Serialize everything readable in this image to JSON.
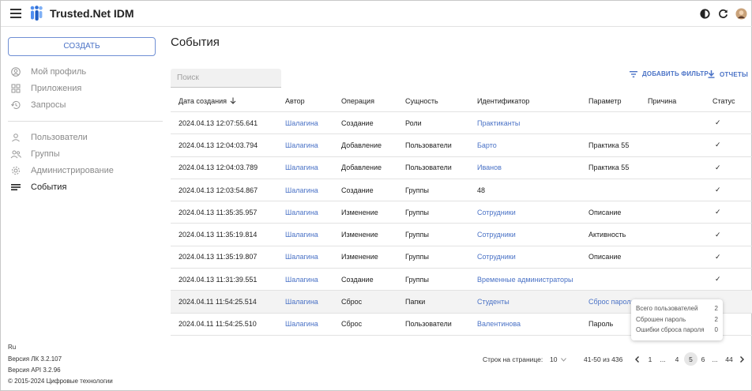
{
  "header": {
    "title": "Trusted.Net IDM",
    "icons": [
      "menu-icon",
      "theme-toggle-icon",
      "refresh-icon",
      "user-avatar-icon"
    ],
    "brand_color": "#2f6fd6"
  },
  "sidebar": {
    "create_label": "СОЗДАТЬ",
    "items": [
      {
        "label": "Мой профиль",
        "icon": "profile-icon"
      },
      {
        "label": "Приложения",
        "icon": "apps-icon"
      },
      {
        "label": "Запросы",
        "icon": "history-icon"
      },
      {
        "label": "Пользователи",
        "icon": "user-icon"
      },
      {
        "label": "Группы",
        "icon": "group-icon"
      },
      {
        "label": "Администрирование",
        "icon": "settings-icon"
      },
      {
        "label": "События",
        "icon": "events-icon",
        "active": true
      }
    ],
    "footer": {
      "lang": "Ru",
      "lk_version": "Версия ЛК 3.2.107",
      "api_version": "Версия API 3.2.96",
      "copyright": "© 2015-2024 Цифровые технологии"
    }
  },
  "main": {
    "title": "События",
    "search_placeholder": "Поиск",
    "add_filter_label": "ДОБАВИТЬ ФИЛЬТР",
    "reports_label": "ОТЧЕТЫ",
    "columns": [
      "Дата создания",
      "Автор",
      "Операция",
      "Сущность",
      "Идентификатор",
      "Параметр",
      "Причина",
      "Статус"
    ],
    "rows": [
      {
        "date": "2024.04.13 12:07:55.641",
        "author": "Шалагина",
        "op": "Создание",
        "entity": "Роли",
        "id": "Практиканты",
        "id_link": true,
        "param": "",
        "param_link": false,
        "reason": "",
        "status": "✓"
      },
      {
        "date": "2024.04.13 12:04:03.794",
        "author": "Шалагина",
        "op": "Добавление",
        "entity": "Пользователи",
        "id": "Барто",
        "id_link": true,
        "param": "Практика 55",
        "param_link": false,
        "reason": "",
        "status": "✓"
      },
      {
        "date": "2024.04.13 12:04:03.789",
        "author": "Шалагина",
        "op": "Добавление",
        "entity": "Пользователи",
        "id": "Иванов",
        "id_link": true,
        "param": "Практика 55",
        "param_link": false,
        "reason": "",
        "status": "✓"
      },
      {
        "date": "2024.04.13 12:03:54.867",
        "author": "Шалагина",
        "op": "Создание",
        "entity": "Группы",
        "id": "48",
        "id_link": false,
        "param": "",
        "param_link": false,
        "reason": "",
        "status": "✓"
      },
      {
        "date": "2024.04.13 11:35:35.957",
        "author": "Шалагина",
        "op": "Изменение",
        "entity": "Группы",
        "id": "Сотрудники",
        "id_link": true,
        "param": "Описание",
        "param_link": false,
        "reason": "",
        "status": "✓"
      },
      {
        "date": "2024.04.13 11:35:19.814",
        "author": "Шалагина",
        "op": "Изменение",
        "entity": "Группы",
        "id": "Сотрудники",
        "id_link": true,
        "param": "Активность",
        "param_link": false,
        "reason": "",
        "status": "✓"
      },
      {
        "date": "2024.04.13 11:35:19.807",
        "author": "Шалагина",
        "op": "Изменение",
        "entity": "Группы",
        "id": "Сотрудники",
        "id_link": true,
        "param": "Описание",
        "param_link": false,
        "reason": "",
        "status": "✓"
      },
      {
        "date": "2024.04.13 11:31:39.551",
        "author": "Шалагина",
        "op": "Создание",
        "entity": "Группы",
        "id": "Временные администраторы",
        "id_link": true,
        "param": "",
        "param_link": false,
        "reason": "",
        "status": "✓"
      },
      {
        "date": "2024.04.11 11:54:25.514",
        "author": "Шалагина",
        "op": "Сброс",
        "entity": "Папки",
        "id": "Студенты",
        "id_link": true,
        "param": "Сброс пароля",
        "param_link": true,
        "reason": "",
        "status": ""
      },
      {
        "date": "2024.04.11 11:54:25.510",
        "author": "Шалагина",
        "op": "Сброс",
        "entity": "Пользователи",
        "id": "Валентинова",
        "id_link": true,
        "param": "Пароль",
        "param_link": false,
        "reason": "",
        "status": ""
      }
    ],
    "tooltip": [
      {
        "label": "Всего пользователей",
        "value": "2"
      },
      {
        "label": "Сброшен пароль",
        "value": "2"
      },
      {
        "label": "Ошибки сброса пароля",
        "value": "0"
      }
    ],
    "pagination": {
      "rows_label": "Строк на странице:",
      "rows_value": "10",
      "range": "41-50 из 436",
      "pages": [
        "1",
        "...",
        "4",
        "5",
        "6",
        "...",
        "44"
      ],
      "current": "5"
    }
  }
}
